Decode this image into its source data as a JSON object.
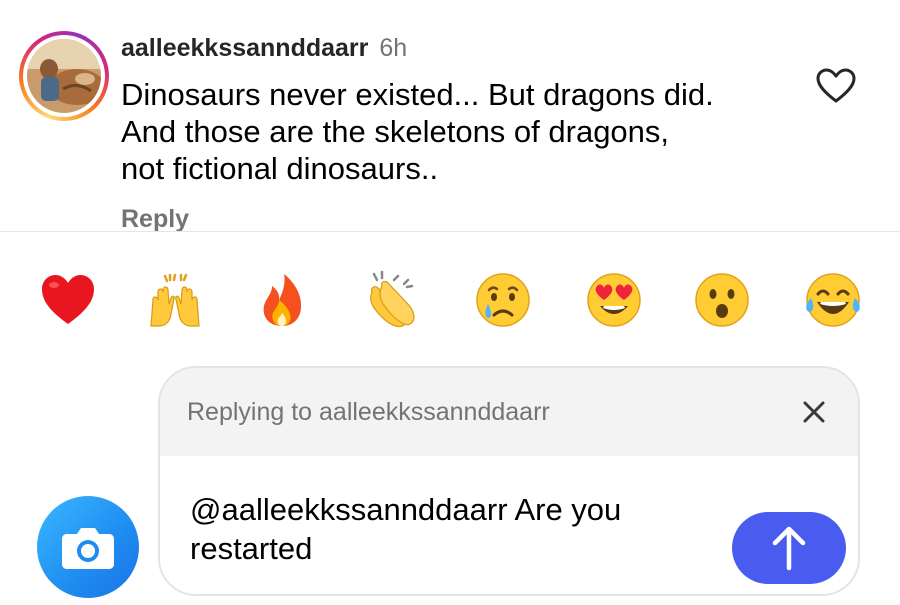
{
  "comment": {
    "username": "aalleekkssannddaarr",
    "time": "6h",
    "lines": [
      "Dinosaurs never existed... But dragons did.",
      "And those are the skeletons of dragons,",
      "not fictional dinosaurs.."
    ],
    "reply_label": "Reply",
    "avatar_icon": "avatar-photo",
    "like_icon": "heart-outline-icon"
  },
  "reactions": [
    {
      "emoji": "❤️",
      "name": "red-heart"
    },
    {
      "emoji": "🙌",
      "name": "raising-hands"
    },
    {
      "emoji": "🔥",
      "name": "fire"
    },
    {
      "emoji": "👏",
      "name": "clapping-hands"
    },
    {
      "emoji": "😢",
      "name": "crying-face"
    },
    {
      "emoji": "😍",
      "name": "heart-eyes"
    },
    {
      "emoji": "😮",
      "name": "open-mouth"
    },
    {
      "emoji": "😂",
      "name": "tears-of-joy"
    }
  ],
  "composer": {
    "replying_to": "Replying to aalleekkssannddaarr",
    "input_lines": [
      "@aalleekkssannddaarr Are you",
      "restarted"
    ],
    "close_icon": "close-icon",
    "send_icon": "arrow-up-icon",
    "camera_icon": "camera-icon"
  },
  "colors": {
    "accent_send": "#4a5cf0",
    "camera_blue": "#1f8cf0",
    "muted_text": "#737373"
  }
}
